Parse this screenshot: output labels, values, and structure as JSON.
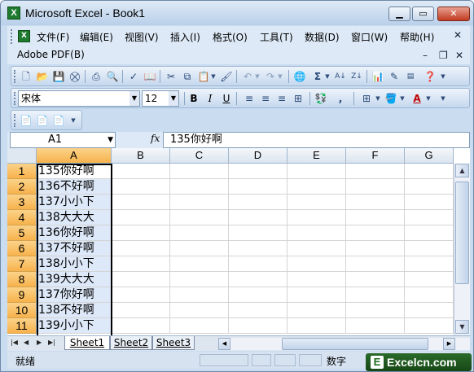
{
  "window": {
    "title": "Microsoft Excel - Book1"
  },
  "menu": {
    "items": [
      "文件(F)",
      "编辑(E)",
      "视图(V)",
      "插入(I)",
      "格式(O)",
      "工具(T)",
      "数据(D)",
      "窗口(W)",
      "帮助(H)"
    ],
    "pdf_label": "Adobe PDF(B)"
  },
  "format": {
    "font_name": "宋体",
    "font_size": "12"
  },
  "formula_bar": {
    "name_box": "A1",
    "fx_label": "fx",
    "content": "135你好啊"
  },
  "grid": {
    "columns": [
      "A",
      "B",
      "C",
      "D",
      "E",
      "F",
      "G"
    ],
    "rows": [
      "1",
      "2",
      "3",
      "4",
      "5",
      "6",
      "7",
      "8",
      "9",
      "10",
      "11"
    ],
    "column_a": [
      "135你好啊",
      "136不好啊",
      "137小小下",
      "138大大大",
      "136你好啊",
      "137不好啊",
      "138小小下",
      "139大大大",
      "137你好啊",
      "138不好啊",
      "139小小下"
    ]
  },
  "sheets": [
    "Sheet1",
    "Sheet2",
    "Sheet3"
  ],
  "status": {
    "ready": "就绪",
    "mode": "数字"
  },
  "watermark": {
    "text": "Excelcn.com",
    "glyph": "E"
  },
  "colors": {
    "title_bar": "#c9dcf0",
    "header_active": "#f7b24c",
    "selection": "#dde8f8"
  }
}
